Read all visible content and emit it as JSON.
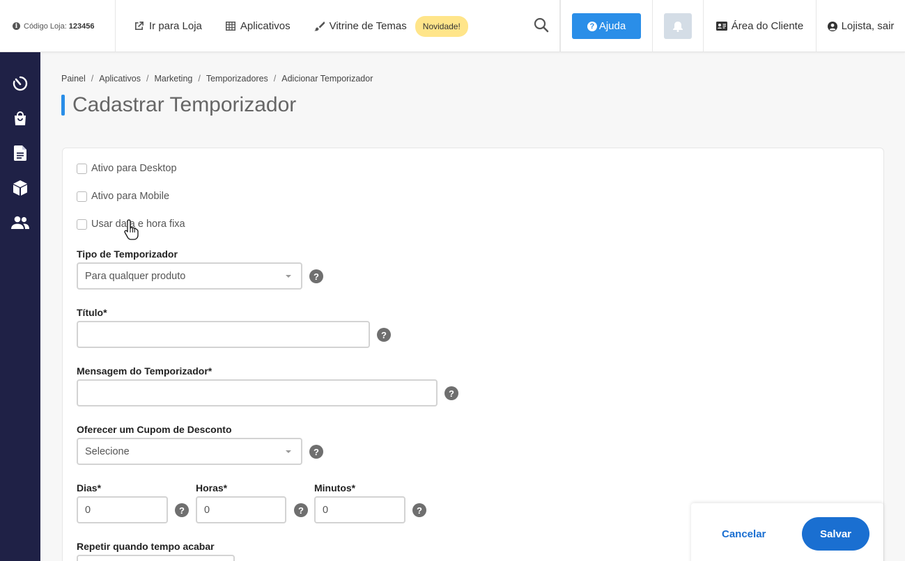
{
  "topbar": {
    "store_code_label": "Código Loja:",
    "store_code_value": "123456",
    "nav": [
      {
        "label": "Ir para Loja",
        "icon": "external-link-icon"
      },
      {
        "label": "Aplicativos",
        "icon": "grid-icon"
      },
      {
        "label": "Vitrine de Temas",
        "icon": "brush-icon"
      }
    ],
    "badge_new": "Novidade!",
    "help_label": "Ajuda",
    "client_area": "Área do Cliente",
    "user_label": "Lojista, sair"
  },
  "sidebar": {
    "items": [
      {
        "icon": "dashboard-timer-icon"
      },
      {
        "icon": "shopping-bag-icon"
      },
      {
        "icon": "document-icon"
      },
      {
        "icon": "box-icon"
      },
      {
        "icon": "users-icon"
      }
    ]
  },
  "breadcrumb": [
    "Painel",
    "Aplicativos",
    "Marketing",
    "Temporizadores",
    "Adicionar Temporizador"
  ],
  "page_title": "Cadastrar Temporizador",
  "form": {
    "checkboxes": {
      "desktop": "Ativo para Desktop",
      "mobile": "Ativo para Mobile",
      "fixed_date": "Usar data e hora fixa"
    },
    "timer_type": {
      "label": "Tipo de Temporizador",
      "value": "Para qualquer produto"
    },
    "title": {
      "label": "Título*",
      "value": ""
    },
    "message": {
      "label": "Mensagem do Temporizador*",
      "value": ""
    },
    "coupon": {
      "label": "Oferecer um Cupom de Desconto",
      "value": "Selecione"
    },
    "days": {
      "label": "Dias*",
      "value": "0"
    },
    "hours": {
      "label": "Horas*",
      "value": "0"
    },
    "minutes": {
      "label": "Minutos*",
      "value": "0"
    },
    "repeat": {
      "label": "Repetir quando tempo acabar"
    },
    "help_glyph": "?"
  },
  "actions": {
    "cancel": "Cancelar",
    "save": "Salvar"
  },
  "colors": {
    "sidebar_bg": "#1f2146",
    "accent_blue": "#2a8ee8",
    "save_blue": "#1a6fd1",
    "badge_yellow": "#ffe58a"
  }
}
